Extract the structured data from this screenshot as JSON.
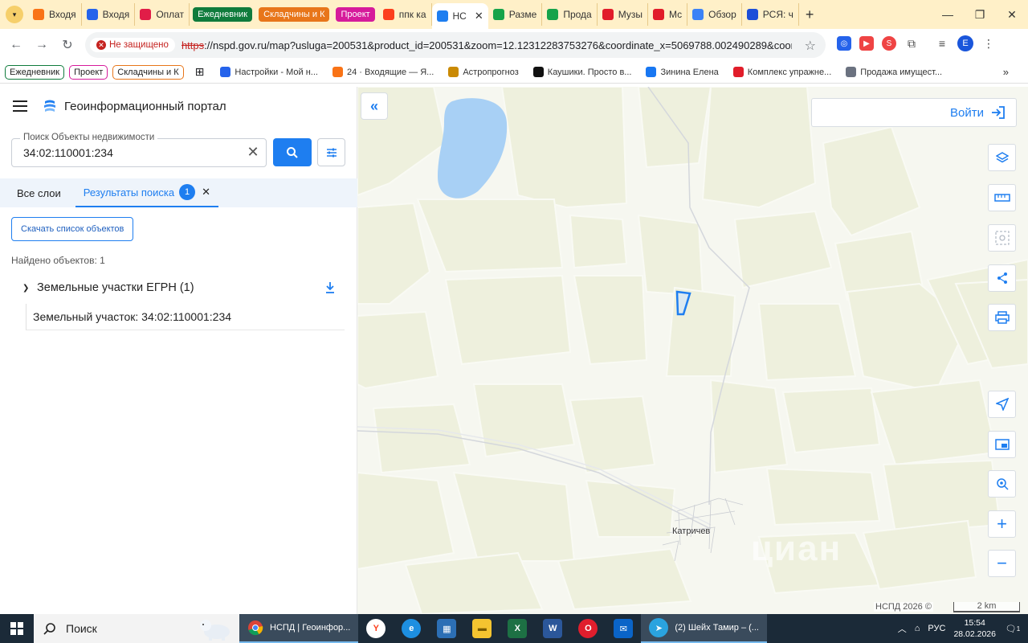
{
  "browser": {
    "tabs": [
      {
        "label": "Входя",
        "icon": "mail-icon",
        "color": "#f97316"
      },
      {
        "label": "Входя",
        "icon": "mail-icon",
        "color": "#2563eb"
      },
      {
        "label": "Оплат",
        "icon": "pinwheel-icon",
        "color": "#e11d48"
      },
      {
        "label": "Ежедневник",
        "pill": true,
        "color": "#0f7b3c"
      },
      {
        "label": "Складчины и К",
        "pill": true,
        "color": "#e8761a"
      },
      {
        "label": "Проект",
        "pill": true,
        "color": "#d61b9b"
      },
      {
        "label": "ппк ка",
        "icon": "yandex-icon",
        "color": "#fc3f1d"
      },
      {
        "label": "НС",
        "icon": "nspd-icon",
        "color": "#1e7ef0",
        "active": true
      },
      {
        "label": "Разме",
        "icon": "house-icon",
        "color": "#16a34a"
      },
      {
        "label": "Прода",
        "icon": "house-icon",
        "color": "#16a34a"
      },
      {
        "label": "Музы",
        "icon": "youtube-icon",
        "color": "#e11d2a"
      },
      {
        "label": "Мс",
        "icon": "youtube-icon",
        "color": "#e11d2a"
      },
      {
        "label": "Обзор",
        "icon": "edge-icon",
        "color": "#3b82f6"
      },
      {
        "label": "РСЯ: ч",
        "icon": "yandex-icon",
        "color": "#1d4ed8"
      }
    ],
    "new_tab": "+",
    "address": {
      "security_label": "Не защищено",
      "url_scheme": "https",
      "url_rest": "://nspd.gov.ru/map?usluga=200531&product_id=200531&zoom=12.12312283753276&coordinate_x=5069788.002490289&coordina..."
    },
    "profile_initial": "E",
    "bookmarks": [
      {
        "label": "Ежедневник",
        "pill": true,
        "color": "#0f7b3c"
      },
      {
        "label": "Проект",
        "pill": true,
        "color": "#d61b9b"
      },
      {
        "label": "Складчины и К",
        "pill": true,
        "color": "#e8761a"
      },
      {
        "label": "Настройки - Мой н...",
        "icon": "settings-icon",
        "color": "#2563eb"
      },
      {
        "label": "24 · Входящие — Я...",
        "icon": "mail-icon",
        "color": "#f97316"
      },
      {
        "label": "Астропрогноз",
        "icon": "astro-icon",
        "color": "#ca8a04"
      },
      {
        "label": "Каушики. Просто в...",
        "icon": "play-icon",
        "color": "#111111"
      },
      {
        "label": "Зинина Елена",
        "icon": "facebook-icon",
        "color": "#1877f2"
      },
      {
        "label": "Комплекс упражне...",
        "icon": "youtube-icon",
        "color": "#e11d2a"
      },
      {
        "label": "Продажа имущест...",
        "icon": "gov-icon",
        "color": "#6b7280"
      }
    ]
  },
  "sidebar": {
    "title": "Геоинформационный портал",
    "search": {
      "label": "Поиск Объекты недвижимости",
      "value": "34:02:110001:234"
    },
    "tabs": {
      "all_layers": "Все слои",
      "results": "Результаты поиска",
      "results_count": "1"
    },
    "download_list": "Скачать список объектов",
    "found": "Найдено объектов: 1",
    "group_title": "Земельные участки ЕГРН (1)",
    "result_item": "Земельный участок: 34:02:110001:234"
  },
  "map": {
    "login": "Войти",
    "settlement": "Катричев",
    "copyright": "НСПД 2026 ©",
    "scale_label": "2 km",
    "watermark": "циан"
  },
  "taskbar": {
    "search_placeholder": "Поиск",
    "chrome_app": "НСПД | Геоинфор...",
    "telegram_app": "(2) Шейх Тамир – (...",
    "language": "РУС",
    "time": "15:54",
    "date": "28.02.2026",
    "notifications": "1"
  },
  "colors": {
    "accent": "#1e7ef0",
    "field": "#eef0dd",
    "background": "#f5f6ef",
    "water": "#a8d0f5",
    "highlight_parcel": "#1e7ef0"
  }
}
